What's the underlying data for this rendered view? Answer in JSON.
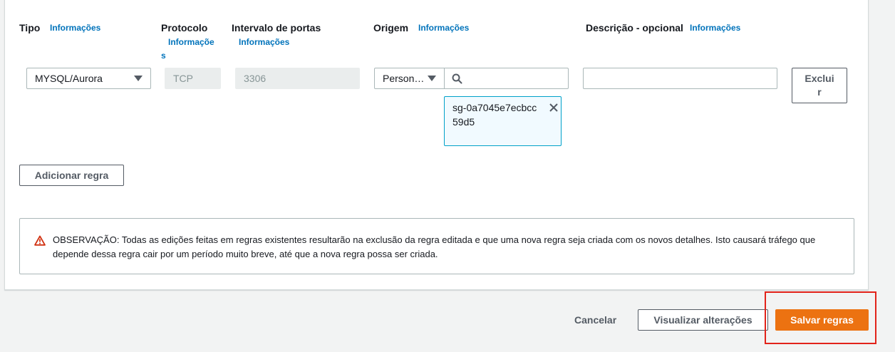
{
  "headers": {
    "tipo": "Tipo",
    "protocolo": "Protocolo",
    "intervalo": "Intervalo de portas",
    "origem": "Origem",
    "descricao": "Descrição - opcional",
    "info": "Informações"
  },
  "rule": {
    "type_value": "MYSQL/Aurora",
    "protocol_value": "TCP",
    "port_range_value": "3306",
    "source_value": "Person…",
    "source_search_value": "",
    "source_token": "sg-0a7045e7ecbcc59d5",
    "description_value": "",
    "delete_label": "Excluir"
  },
  "add_rule_label": "Adicionar regra",
  "alert": {
    "text": "OBSERVAÇÃO: Todas as edições feitas em regras existentes resultarão na exclusão da regra editada e que uma nova regra seja criada com os novos detalhes. Isto causará tráfego que depende dessa regra cair por um período muito breve, até que a nova regra possa ser criada."
  },
  "footer": {
    "cancel_label": "Cancelar",
    "preview_label": "Visualizar alterações",
    "save_label": "Salvar regras"
  },
  "colors": {
    "primary": "#ec7211",
    "link": "#0073bb",
    "warning": "#d13212",
    "highlight": "#e2231a"
  }
}
